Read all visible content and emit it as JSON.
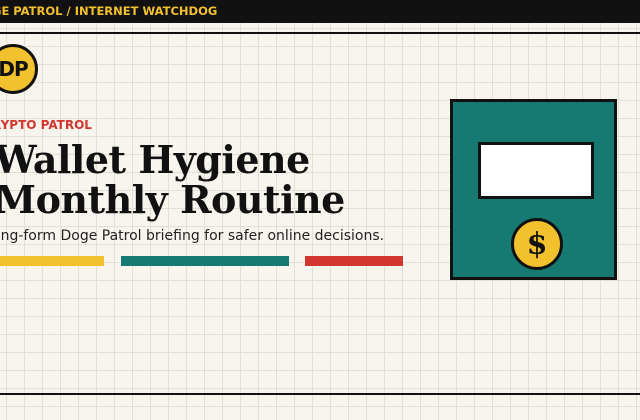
{
  "header": {
    "tagline": "GE PATROL / INTERNET WATCHDOG"
  },
  "logo": {
    "initials": "DP"
  },
  "article": {
    "kicker": "RYPTO PATROL",
    "title_line1": "Wallet Hygiene",
    "title_line2": "Monthly Routine",
    "subtitle": "ong-form Doge Patrol briefing for safer online decisions."
  },
  "illustration": {
    "coin_symbol": "$",
    "icon": "wallet-icon"
  },
  "colors": {
    "accent_yellow": "#f2c12e",
    "accent_teal": "#167a72",
    "accent_red": "#d1362f",
    "ink": "#111111",
    "paper": "#f7f5ee"
  }
}
